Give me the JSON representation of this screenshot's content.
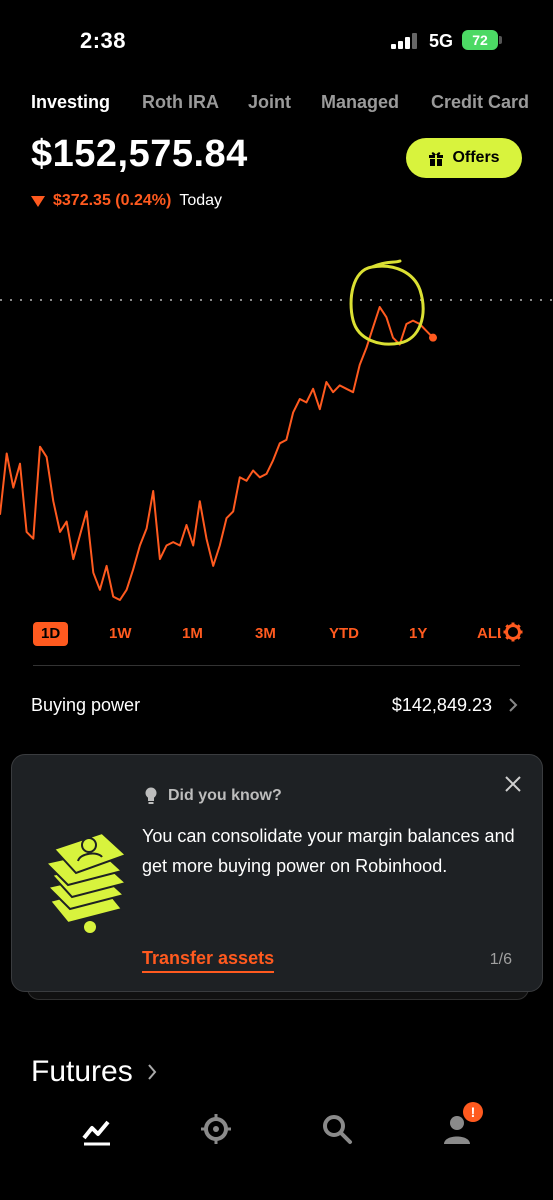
{
  "status_bar": {
    "time": "2:38",
    "network": "5G",
    "battery": "72"
  },
  "account_tabs": [
    {
      "label": "Investing",
      "active": true
    },
    {
      "label": "Roth IRA",
      "active": false
    },
    {
      "label": "Joint",
      "active": false
    },
    {
      "label": "Managed",
      "active": false
    },
    {
      "label": "Credit Card",
      "active": false
    }
  ],
  "portfolio": {
    "value": "$152,575.84",
    "change": "$372.35 (0.24%)",
    "change_period": "Today",
    "change_direction": "down"
  },
  "offers_button": {
    "label": "Offers",
    "icon": "gift-icon"
  },
  "chart_data": {
    "type": "line",
    "series": [
      {
        "values": [
          125,
          143,
          133,
          140,
          120,
          118,
          145,
          142,
          129,
          120,
          123,
          112,
          119,
          126,
          108,
          103,
          110,
          101,
          100,
          103,
          109,
          116,
          121,
          132,
          112,
          116,
          117,
          116,
          122,
          116,
          129,
          118,
          110,
          116,
          124,
          126,
          136,
          135,
          138,
          136,
          137,
          141,
          146,
          147,
          155,
          159,
          158,
          162,
          156,
          164,
          161,
          163,
          162,
          161,
          169,
          174,
          180,
          186,
          183,
          177,
          175,
          181,
          182,
          181,
          179,
          177
        ],
        "color": "#ff5a1f"
      }
    ],
    "reference_line": "dotted",
    "highlight": "circle-around-peak",
    "colors": {
      "line": "#ff5a1f",
      "annotation": "#dbe033",
      "reference": "#888888"
    }
  },
  "range_tabs": [
    {
      "label": "1D",
      "active": true
    },
    {
      "label": "1W",
      "active": false
    },
    {
      "label": "1M",
      "active": false
    },
    {
      "label": "3M",
      "active": false
    },
    {
      "label": "YTD",
      "active": false
    },
    {
      "label": "1Y",
      "active": false
    },
    {
      "label": "ALL",
      "active": false
    }
  ],
  "buying_power": {
    "label": "Buying power",
    "value": "$142,849.23"
  },
  "tip_card": {
    "header": "Did you know?",
    "body": "You can consolidate your margin balances and get more buying power on Robinhood.",
    "link": "Transfer assets",
    "pager": "1/6"
  },
  "futures": {
    "title": "Futures"
  },
  "bottom_nav": [
    {
      "icon": "investing-chart-icon",
      "active": true
    },
    {
      "icon": "crypto-icon",
      "active": false
    },
    {
      "icon": "search-icon",
      "active": false
    },
    {
      "icon": "account-icon",
      "active": false,
      "badge": "!"
    }
  ],
  "colors": {
    "accent": "#ff5a1f",
    "offers": "#d8f33d",
    "card": "#1e2124"
  }
}
